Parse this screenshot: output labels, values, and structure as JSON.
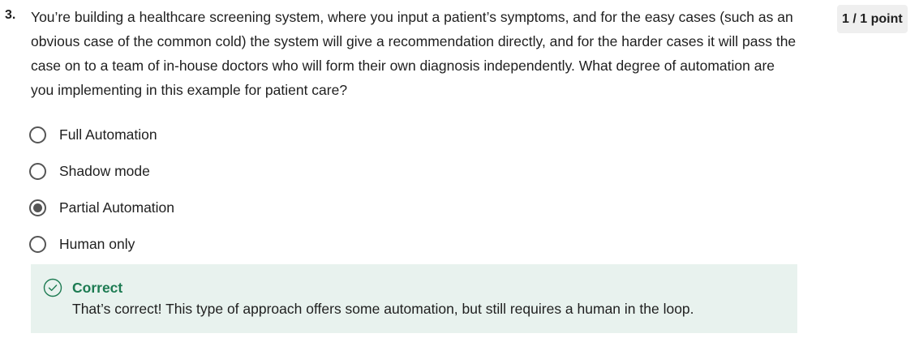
{
  "question": {
    "number": "3.",
    "text": "You’re building a healthcare screening system, where you input a patient’s symptoms, and for the easy cases (such as an obvious case of the common cold) the system will give a recommendation directly, and for the harder cases it will pass the case on to a team of in-house doctors who will form their own diagnosis independently. What degree of automation are you implementing in this example for patient care?",
    "points": "1 / 1 point"
  },
  "options": [
    {
      "label": "Full Automation",
      "selected": false
    },
    {
      "label": "Shadow mode",
      "selected": false
    },
    {
      "label": "Partial Automation",
      "selected": true
    },
    {
      "label": "Human only",
      "selected": false
    }
  ],
  "feedback": {
    "icon": "check-circle-icon",
    "title": "Correct",
    "text": "That’s correct! This type of approach offers some automation, but still requires a human in the loop.",
    "accent_color": "#1d7b52",
    "background_color": "#e8f2ee"
  }
}
